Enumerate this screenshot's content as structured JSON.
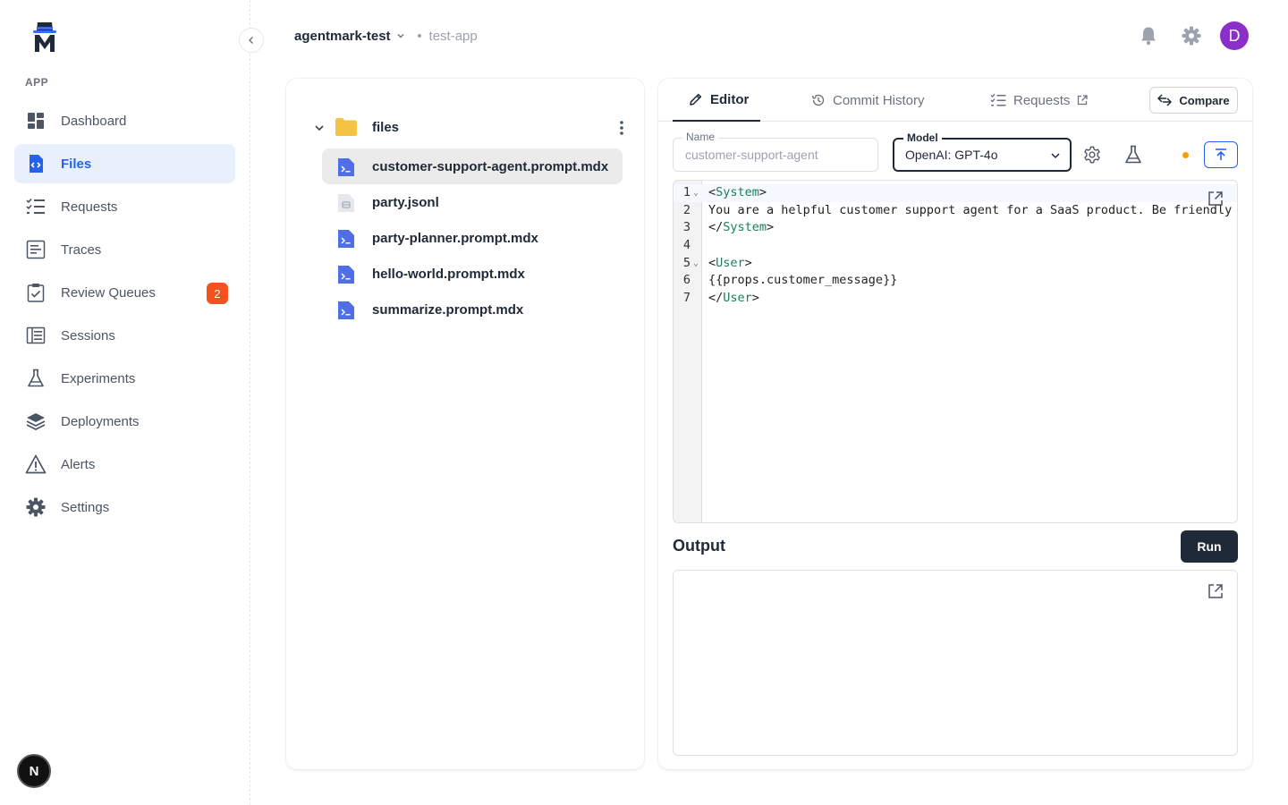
{
  "sidebar": {
    "section_label": "APP",
    "items": [
      {
        "label": "Dashboard",
        "icon": "dashboard-icon"
      },
      {
        "label": "Files",
        "icon": "files-icon",
        "active": true
      },
      {
        "label": "Requests",
        "icon": "requests-icon"
      },
      {
        "label": "Traces",
        "icon": "traces-icon"
      },
      {
        "label": "Review Queues",
        "icon": "review-queues-icon",
        "badge": "2"
      },
      {
        "label": "Sessions",
        "icon": "sessions-icon"
      },
      {
        "label": "Experiments",
        "icon": "experiments-icon"
      },
      {
        "label": "Deployments",
        "icon": "deployments-icon"
      },
      {
        "label": "Alerts",
        "icon": "alerts-icon"
      },
      {
        "label": "Settings",
        "icon": "settings-icon"
      }
    ],
    "footer_avatar": "N"
  },
  "header": {
    "org": "agentmark-test",
    "project": "test-app",
    "user_initial": "D"
  },
  "file_tree": {
    "folder": "files",
    "files": [
      {
        "name": "customer-support-agent.prompt.mdx",
        "type": "prompt",
        "selected": true
      },
      {
        "name": "party.jsonl",
        "type": "dataset"
      },
      {
        "name": "party-planner.prompt.mdx",
        "type": "prompt"
      },
      {
        "name": "hello-world.prompt.mdx",
        "type": "prompt"
      },
      {
        "name": "summarize.prompt.mdx",
        "type": "prompt"
      }
    ]
  },
  "editor": {
    "tabs": [
      {
        "label": "Editor",
        "icon": "pencil-icon",
        "active": true
      },
      {
        "label": "Commit History",
        "icon": "history-icon"
      },
      {
        "label": "Requests",
        "icon": "requests-list-icon",
        "external": true
      }
    ],
    "compare_label": "Compare",
    "name_field": {
      "label": "Name",
      "value": "customer-support-agent"
    },
    "model_field": {
      "label": "Model",
      "value": "OpenAI: GPT-4o"
    },
    "code": [
      {
        "n": "1",
        "fold": true,
        "tokens": [
          [
            "p",
            "<"
          ],
          [
            "t",
            "System"
          ],
          [
            "p",
            ">"
          ]
        ]
      },
      {
        "n": "2",
        "fold": false,
        "tokens": [
          [
            "p",
            "You are a helpful customer support agent for a SaaS product. Be friendly"
          ]
        ]
      },
      {
        "n": "3",
        "fold": false,
        "tokens": [
          [
            "p",
            "</"
          ],
          [
            "t",
            "System"
          ],
          [
            "p",
            ">"
          ]
        ]
      },
      {
        "n": "4",
        "fold": false,
        "tokens": []
      },
      {
        "n": "5",
        "fold": true,
        "tokens": [
          [
            "p",
            "<"
          ],
          [
            "t",
            "User"
          ],
          [
            "p",
            ">"
          ]
        ]
      },
      {
        "n": "6",
        "fold": false,
        "tokens": [
          [
            "p",
            "{{props.customer_message}}"
          ]
        ]
      },
      {
        "n": "7",
        "fold": false,
        "tokens": [
          [
            "p",
            "</"
          ],
          [
            "t",
            "User"
          ],
          [
            "p",
            ">"
          ]
        ]
      }
    ],
    "output_title": "Output",
    "run_label": "Run"
  },
  "colors": {
    "accent": "#2563eb",
    "active_nav_bg": "#e8f0fe",
    "badge": "#f4511e",
    "avatar": "#8b2fc9",
    "status_dot": "#f59e0b",
    "folder": "#f6c445",
    "prompt_file": "#4f6fe8"
  }
}
